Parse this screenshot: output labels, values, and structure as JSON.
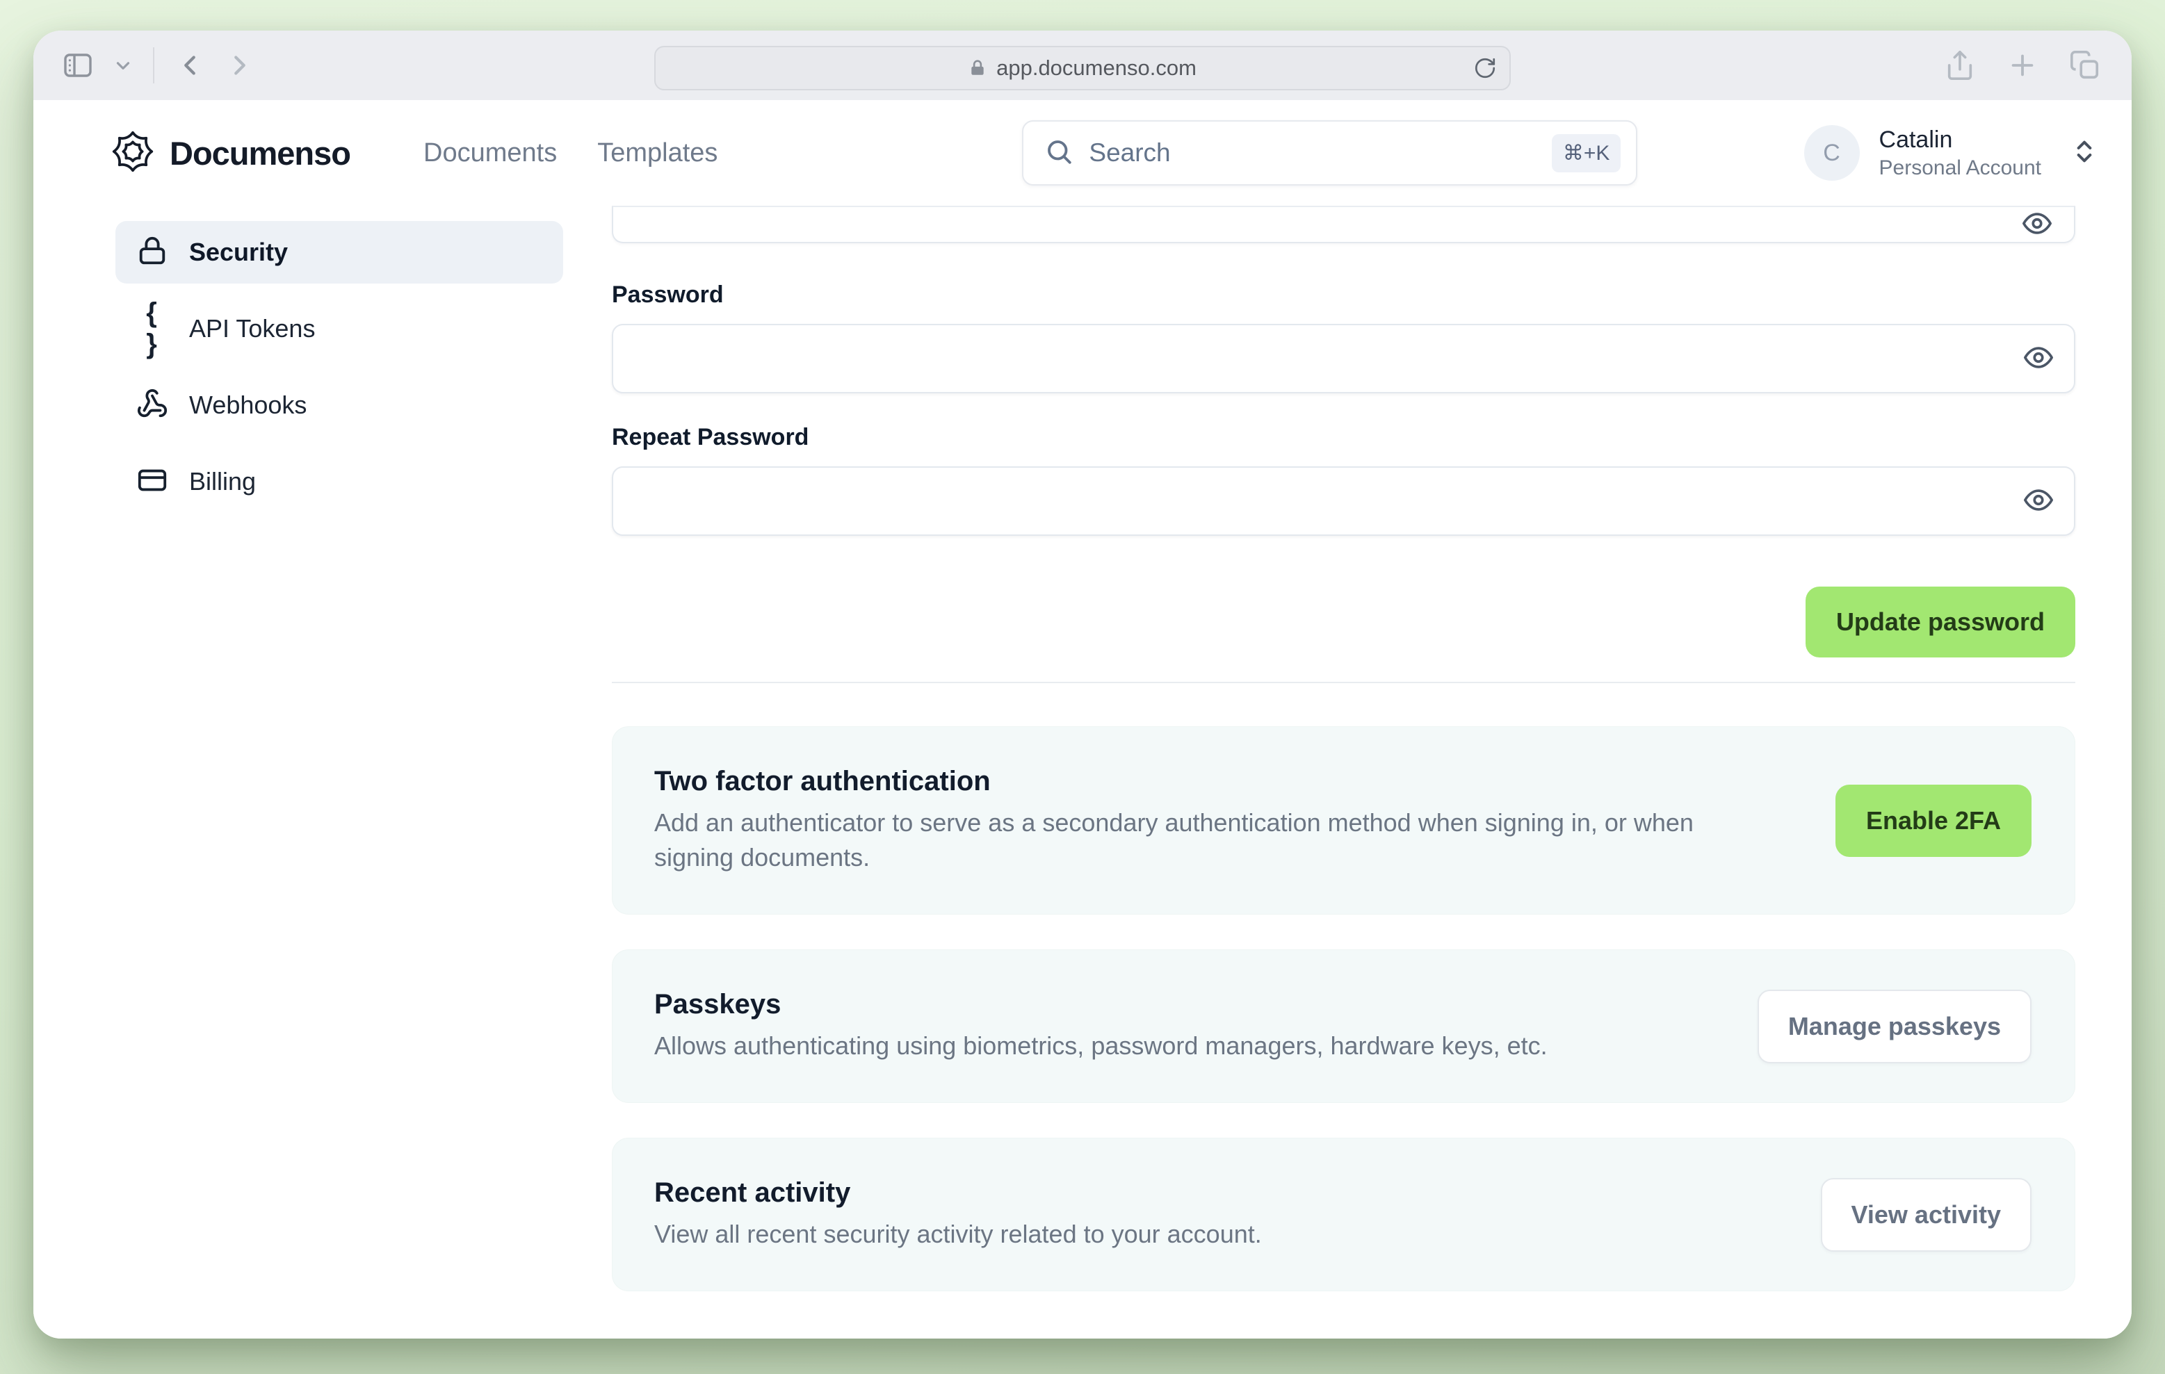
{
  "colors": {
    "accent_green": "#a2e771",
    "on_accent_green": "#233c17",
    "desktop_background": "#def0d5",
    "card_background": "#f3f9f9",
    "sidebar_active_background": "#edf1f6"
  },
  "browser": {
    "address_url": "app.documenso.com",
    "icons": {
      "sidebar_toggle": "panel-left-icon",
      "toolbar_dropdown": "chevron-down-icon",
      "back": "chevron-left-icon",
      "forward": "chevron-right-icon",
      "lock": "padlock-icon",
      "reload": "reload-icon",
      "share": "share-icon",
      "new_tab": "plus-icon",
      "tab_overview": "tabs-icon"
    }
  },
  "header": {
    "logo_text": "Documenso",
    "nav": [
      {
        "label": "Documents"
      },
      {
        "label": "Templates"
      }
    ],
    "search": {
      "placeholder": "Search",
      "shortcut": "⌘+K"
    },
    "account": {
      "initial": "C",
      "name": "Catalin",
      "type": "Personal Account"
    }
  },
  "sidebar": {
    "items": [
      {
        "label": "Security",
        "icon": "lock-icon",
        "active": true
      },
      {
        "label": "API Tokens",
        "icon": "braces-icon",
        "glyph": "{ }",
        "active": false
      },
      {
        "label": "Webhooks",
        "icon": "webhook-icon",
        "active": false
      },
      {
        "label": "Billing",
        "icon": "credit-card-icon",
        "active": false
      }
    ]
  },
  "main": {
    "password_form": {
      "password_label": "Password",
      "repeat_label": "Repeat Password",
      "submit_label": "Update password"
    },
    "cards": [
      {
        "title": "Two factor authentication",
        "description": "Add an authenticator to serve as a secondary authentication method when signing in, or when signing documents.",
        "button": "Enable 2FA"
      },
      {
        "title": "Passkeys",
        "description": "Allows authenticating using biometrics, password managers, hardware keys, etc.",
        "button": "Manage passkeys"
      },
      {
        "title": "Recent activity",
        "description": "View all recent security activity related to your account.",
        "button": "View activity"
      }
    ]
  }
}
